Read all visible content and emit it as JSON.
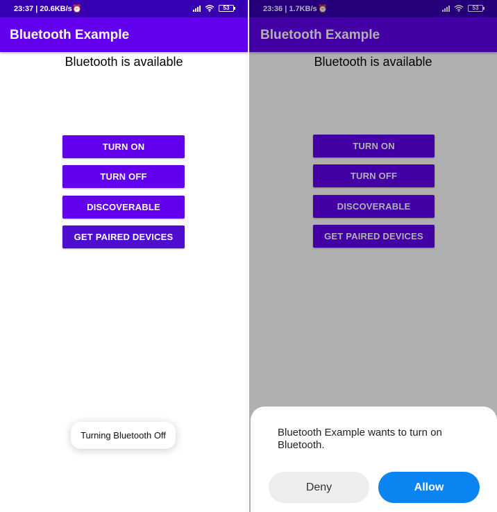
{
  "colors": {
    "primary": "#6200ee",
    "primary_dark": "#3700b3",
    "button_pressed": "#4f0dcf",
    "allow_button": "#0a84f0",
    "deny_button": "#ededed"
  },
  "left": {
    "status_bar": {
      "time_speed": "23:37 | 20.6KB/s",
      "battery": "53",
      "icons": [
        "alarm-icon",
        "signal-icon",
        "wifi-icon",
        "battery-icon"
      ]
    },
    "app_title": "Bluetooth Example",
    "status_message": "Bluetooth is available",
    "buttons": {
      "turn_on": "TURN ON",
      "turn_off": "TURN OFF",
      "discoverable": "DISCOVERABLE",
      "paired": "GET PAIRED DEVICES"
    },
    "toast": "Turning Bluetooth Off"
  },
  "right": {
    "status_bar": {
      "time_speed": "23:36 | 1.7KB/s",
      "battery": "53",
      "icons": [
        "alarm-icon",
        "signal-icon",
        "wifi-icon",
        "battery-icon"
      ]
    },
    "app_title": "Bluetooth Example",
    "status_message": "Bluetooth is available",
    "buttons": {
      "turn_on": "TURN ON",
      "turn_off": "TURN OFF",
      "discoverable": "DISCOVERABLE",
      "paired": "GET PAIRED DEVICES"
    },
    "dialog": {
      "message": "Bluetooth Example wants to turn on Bluetooth.",
      "deny": "Deny",
      "allow": "Allow"
    }
  }
}
